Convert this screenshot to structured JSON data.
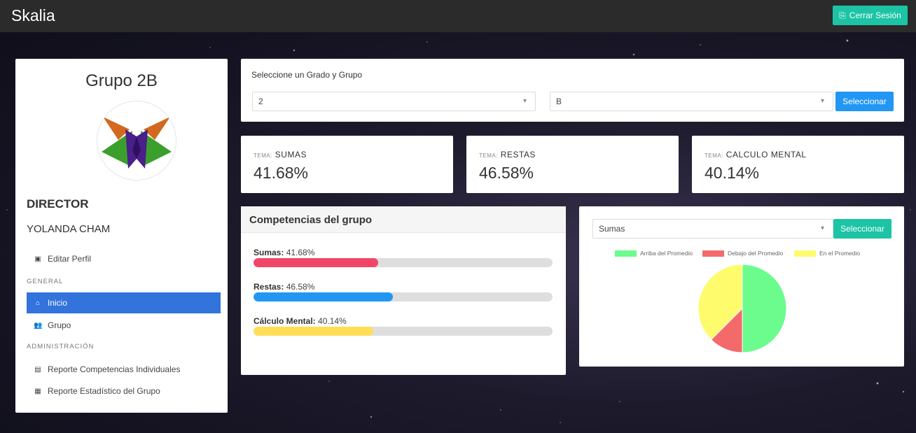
{
  "app": {
    "brand": "Skalia",
    "logout_label": "Cerrar Sesión"
  },
  "sidebar": {
    "group_title": "Grupo 2B",
    "role": "DIRECTOR",
    "user_name": "YOLANDA CHAM",
    "edit_profile": "Editar Perfil",
    "section_general": "GENERAL",
    "section_admin": "ADMINISTRACIÓN",
    "items": [
      {
        "label": "Inicio",
        "icon": "home-icon",
        "active": true
      },
      {
        "label": "Grupo",
        "icon": "users-icon",
        "active": false
      },
      {
        "label": "Reporte Competencias Individuales",
        "icon": "report-icon",
        "active": false
      },
      {
        "label": "Reporte Estadístico del Grupo",
        "icon": "chart-icon",
        "active": false
      }
    ]
  },
  "selector": {
    "label": "Seleccione un Grado y Grupo",
    "grade_value": "2",
    "group_value": "B",
    "button": "Seleccionar"
  },
  "stats": [
    {
      "prefix": "TEMA:",
      "topic": "SUMAS",
      "value": "41.68%"
    },
    {
      "prefix": "TEMA:",
      "topic": "RESTAS",
      "value": "46.58%"
    },
    {
      "prefix": "TEMA:",
      "topic": "CALCULO MENTAL",
      "value": "40.14%"
    }
  ],
  "competencias": {
    "title": "Competencias del grupo",
    "items": [
      {
        "name": "Sumas:",
        "value": "41.68%",
        "percent": 41.68,
        "color": "#f14668"
      },
      {
        "name": "Restas:",
        "value": "46.58%",
        "percent": 46.58,
        "color": "#2196f3"
      },
      {
        "name": "Cálculo Mental:",
        "value": "40.14%",
        "percent": 40.14,
        "color": "#ffdd57"
      }
    ]
  },
  "pie_panel": {
    "select_value": "Sumas",
    "button": "Seleccionar",
    "legend": [
      {
        "label": "Arriba del Promedio",
        "color": "#6cfc8e"
      },
      {
        "label": "Debajo del Promedio",
        "color": "#f46a6a"
      },
      {
        "label": "En el Promedio",
        "color": "#fefc6c"
      }
    ]
  },
  "chart_data": {
    "type": "pie",
    "labels": [
      "Arriba del Promedio",
      "Debajo del Promedio",
      "En el Promedio"
    ],
    "values": [
      50,
      12.5,
      37.5
    ],
    "colors": [
      "#6cfc8e",
      "#f46a6a",
      "#fefc6c"
    ],
    "legend_position": "top"
  }
}
